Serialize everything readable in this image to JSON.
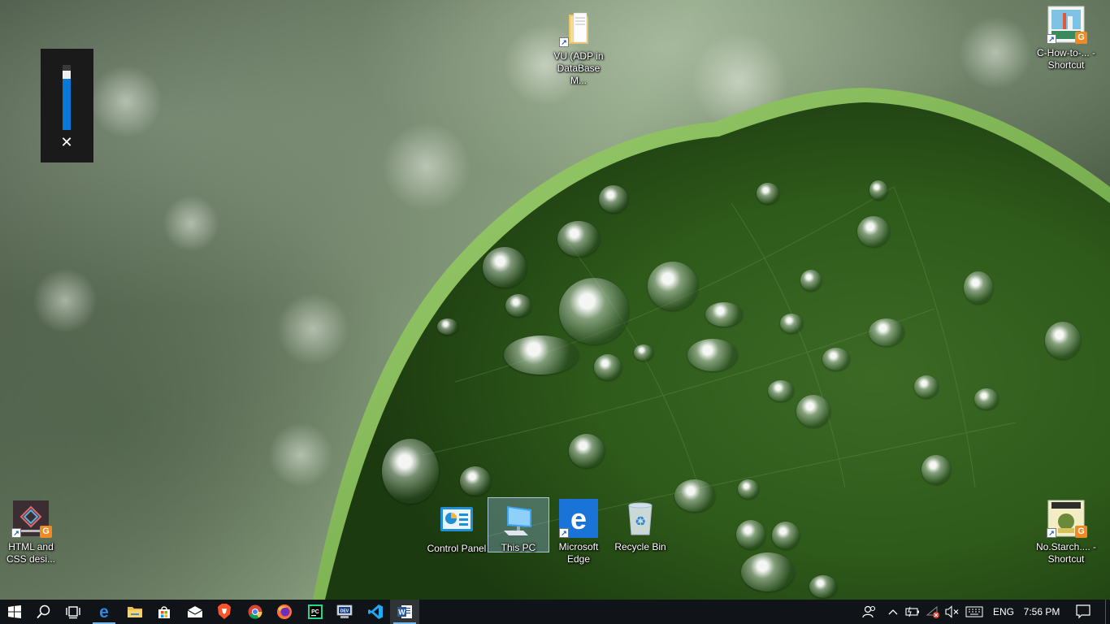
{
  "desktop": {
    "icons": {
      "vu_folder": {
        "label": "VU (ADP in DataBase M..."
      },
      "c_how_to": {
        "label": "C-How-to-... - Shortcut"
      },
      "html_css": {
        "label": "HTML and CSS desi..."
      },
      "control_panel": {
        "label": "Control Panel"
      },
      "this_pc": {
        "label": "This PC"
      },
      "edge": {
        "label": "Microsoft Edge"
      },
      "recycle_bin": {
        "label": "Recycle Bin"
      },
      "no_starch": {
        "label": "No.Starch.... - Shortcut"
      }
    }
  },
  "volume_flyout": {
    "level_fraction": 0.9,
    "mute_glyph": "✕"
  },
  "taskbar": {
    "pinned": [
      "windows-start",
      "search",
      "task-view",
      "edge",
      "file-explorer",
      "store",
      "mail",
      "brave",
      "chrome",
      "firefox",
      "pycharm",
      "devcpp",
      "vscode",
      "word"
    ],
    "tray": {
      "language": "ENG",
      "time": "7:56 PM"
    }
  },
  "colors": {
    "accent": "#0a78d7",
    "taskbar_bg": "#101317",
    "selection": "#96bee6"
  }
}
